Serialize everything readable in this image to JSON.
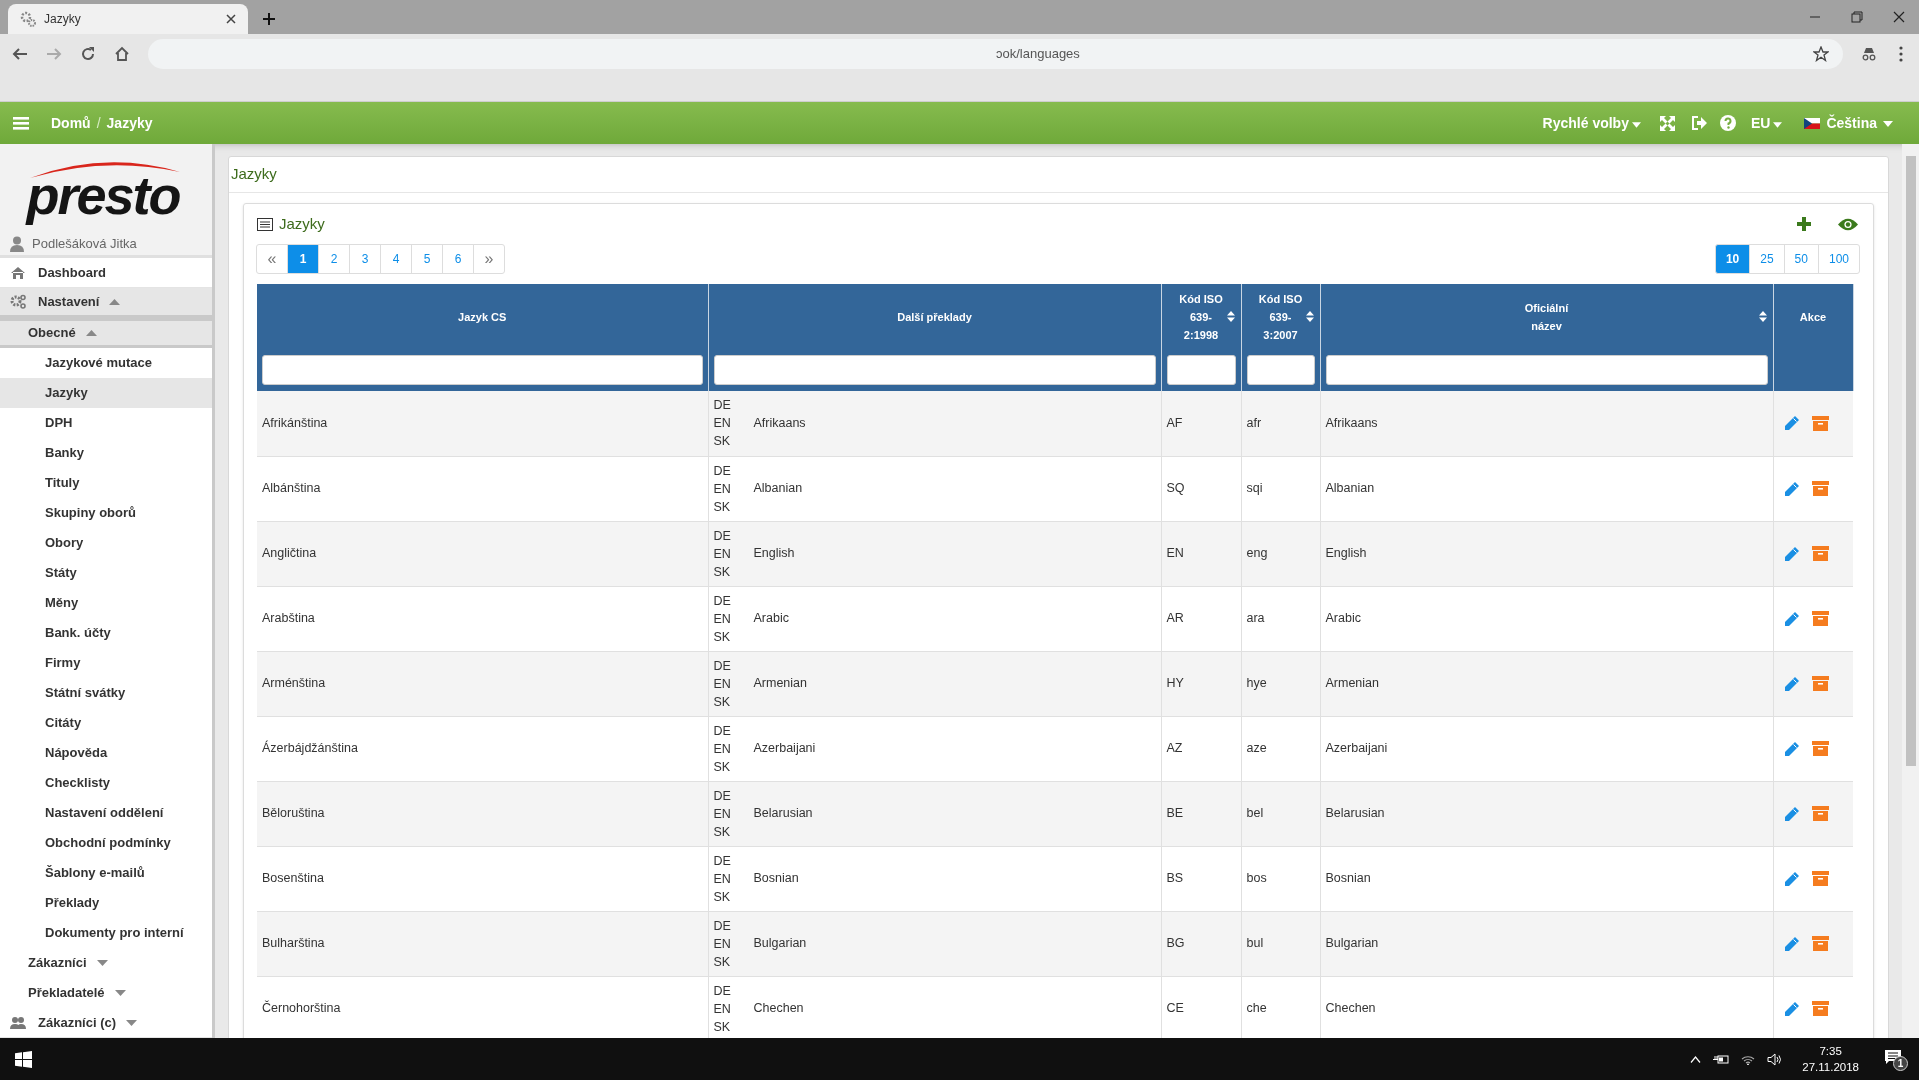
{
  "browser": {
    "tab_title": "Jazyky",
    "url": "ɔok/languages"
  },
  "header": {
    "breadcrumbs": [
      "Domů",
      "Jazyky"
    ],
    "breadcrumb_separator": "/",
    "quick_menu": "Rychlé volby",
    "region": "EU",
    "language": "Čeština"
  },
  "sidebar": {
    "logo": "presto",
    "user": "Podlešáková Jitka",
    "items": [
      {
        "label": "Dashboard"
      },
      {
        "label": "Nastavení",
        "expanded": true,
        "children": [
          {
            "label": "Obecné",
            "expanded": true,
            "children": [
              {
                "label": "Jazykové mutace",
                "selected": false
              },
              {
                "label": "Jazyky",
                "selected": true
              },
              {
                "label": "DPH",
                "selected": false
              },
              {
                "label": "Banky",
                "selected": false
              },
              {
                "label": "Tituly",
                "selected": false
              },
              {
                "label": "Skupiny oborů",
                "selected": false
              },
              {
                "label": "Obory",
                "selected": false
              },
              {
                "label": "Státy",
                "selected": false
              },
              {
                "label": "Měny",
                "selected": false
              },
              {
                "label": "Bank. účty",
                "selected": false
              },
              {
                "label": "Firmy",
                "selected": false
              },
              {
                "label": "Státní svátky",
                "selected": false
              },
              {
                "label": "Citáty",
                "selected": false
              },
              {
                "label": "Nápověda",
                "selected": false
              },
              {
                "label": "Checklisty",
                "selected": false
              },
              {
                "label": "Nastavení oddělení",
                "selected": false
              },
              {
                "label": "Obchodní podmínky",
                "selected": false
              },
              {
                "label": "Šablony e-mailů",
                "selected": false
              },
              {
                "label": "Překlady",
                "selected": false
              },
              {
                "label": "Dokumenty pro interní",
                "selected": false
              }
            ]
          },
          {
            "label": "Zákazníci",
            "expanded": false
          },
          {
            "label": "Překladatelé",
            "expanded": false
          }
        ]
      },
      {
        "label": "Zákazníci (c)",
        "expanded": false
      }
    ]
  },
  "page_title": "Jazyky",
  "panel": {
    "title": "Jazyky",
    "pages": [
      {
        "label": "«",
        "selected": false
      },
      {
        "label": "1",
        "selected": true
      },
      {
        "label": "2",
        "selected": false
      },
      {
        "label": "3",
        "selected": false
      },
      {
        "label": "4",
        "selected": false
      },
      {
        "label": "5",
        "selected": false
      },
      {
        "label": "6",
        "selected": false
      },
      {
        "label": "»",
        "selected": false
      }
    ],
    "page_sizes": [
      {
        "label": "10",
        "selected": true
      },
      {
        "label": "25",
        "selected": false
      },
      {
        "label": "50",
        "selected": false
      },
      {
        "label": "100",
        "selected": false
      }
    ],
    "table": {
      "columns": [
        {
          "label": "Jazyk CS",
          "sortable": false,
          "filter": true
        },
        {
          "label": "Další překlady",
          "sortable": false,
          "filter": true
        },
        {
          "label": "Kód ISO 639-2:1998",
          "sortable": true,
          "filter": true
        },
        {
          "label": "Kód ISO 639-3:2007",
          "sortable": true,
          "filter": true
        },
        {
          "label": "Oficiální název",
          "sortable": true,
          "filter": true
        },
        {
          "label": "Akce",
          "sortable": false,
          "filter": false
        }
      ],
      "rows": [
        {
          "name": "Afrikánština",
          "codes": [
            "DE",
            "EN",
            "SK"
          ],
          "translation": "Afrikaans",
          "iso2": "AF",
          "iso3": "afr",
          "official": "Afrikaans"
        },
        {
          "name": "Albánština",
          "codes": [
            "DE",
            "EN",
            "SK"
          ],
          "translation": "Albanian",
          "iso2": "SQ",
          "iso3": "sqi",
          "official": "Albanian"
        },
        {
          "name": "Angličtina",
          "codes": [
            "DE",
            "EN",
            "SK"
          ],
          "translation": "English",
          "iso2": "EN",
          "iso3": "eng",
          "official": "English"
        },
        {
          "name": "Arabština",
          "codes": [
            "DE",
            "EN",
            "SK"
          ],
          "translation": "Arabic",
          "iso2": "AR",
          "iso3": "ara",
          "official": "Arabic"
        },
        {
          "name": "Arménština",
          "codes": [
            "DE",
            "EN",
            "SK"
          ],
          "translation": "Armenian",
          "iso2": "HY",
          "iso3": "hye",
          "official": "Armenian"
        },
        {
          "name": "Ázerbájdžánština",
          "codes": [
            "DE",
            "EN",
            "SK"
          ],
          "translation": "Azerbaijani",
          "iso2": "AZ",
          "iso3": "aze",
          "official": "Azerbaijani"
        },
        {
          "name": "Běloruština",
          "codes": [
            "DE",
            "EN",
            "SK"
          ],
          "translation": "Belarusian",
          "iso2": "BE",
          "iso3": "bel",
          "official": "Belarusian"
        },
        {
          "name": "Bosenština",
          "codes": [
            "DE",
            "EN",
            "SK"
          ],
          "translation": "Bosnian",
          "iso2": "BS",
          "iso3": "bos",
          "official": "Bosnian"
        },
        {
          "name": "Bulharština",
          "codes": [
            "DE",
            "EN",
            "SK"
          ],
          "translation": "Bulgarian",
          "iso2": "BG",
          "iso3": "bul",
          "official": "Bulgarian"
        },
        {
          "name": "Černohorština",
          "codes": [
            "DE",
            "EN",
            "SK"
          ],
          "translation": "Chechen",
          "iso2": "CE",
          "iso3": "che",
          "official": "Chechen"
        }
      ]
    }
  },
  "taskbar": {
    "time": "7:35",
    "date": "27.11.2018",
    "notifications": "1"
  }
}
